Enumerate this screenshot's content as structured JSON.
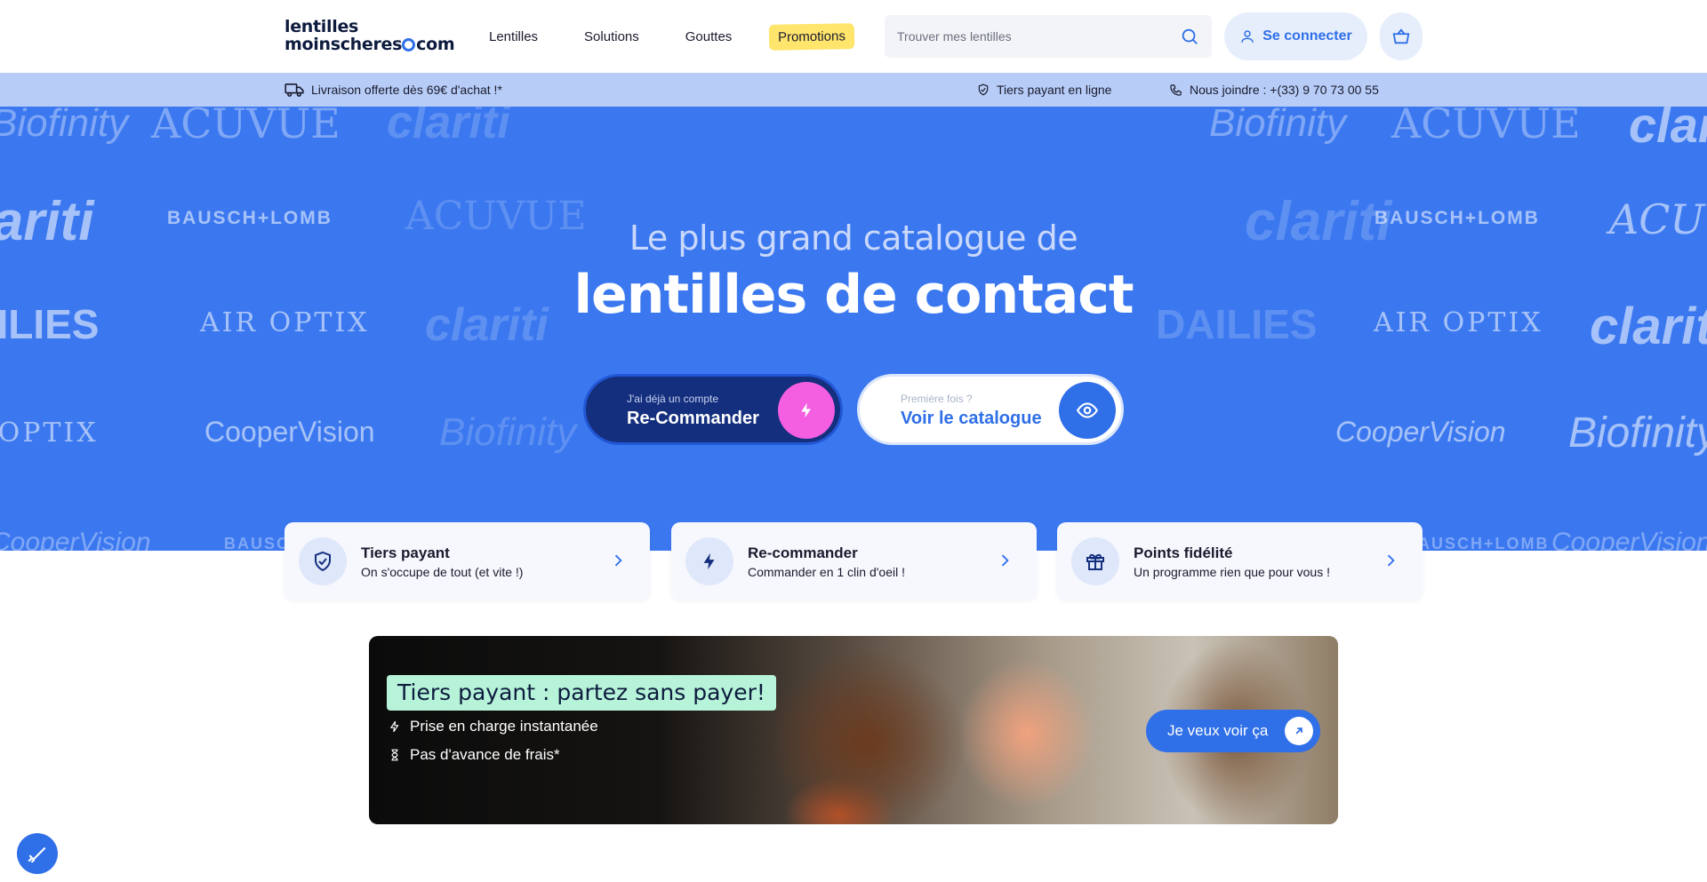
{
  "header": {
    "logo_line1": "lentilles",
    "logo_line2_a": "moinscheres",
    "logo_line2_b": "com",
    "nav": [
      "Lentilles",
      "Solutions",
      "Gouttes",
      "Promotions"
    ],
    "search_placeholder": "Trouver mes lentilles",
    "login_label": "Se connecter"
  },
  "infobar": {
    "delivery": "Livraison offerte dès 69€ d'achat !*",
    "tiers_payant": "Tiers payant en ligne",
    "contact": "Nous joindre : +(33) 9 70 73 00 55"
  },
  "hero": {
    "subtitle": "Le plus grand catalogue de",
    "title": "lentilles de contact",
    "brands": [
      "ACUVUE",
      "clariti",
      "BAUSCH+LOMB",
      "DAILIES",
      "AIR OPTIX",
      "CooperVision",
      "Biofinity"
    ],
    "reorder_small": "J'ai déjà un compte",
    "reorder_big": "Re-Commander",
    "catalog_small": "Première fois ?",
    "catalog_big": "Voir le catalogue"
  },
  "cards": [
    {
      "title": "Tiers payant",
      "subtitle": "On s'occupe de tout (et vite !)",
      "icon": "shield-check-icon"
    },
    {
      "title": "Re-commander",
      "subtitle": "Commander en 1 clin d'oeil !",
      "icon": "lightning-icon"
    },
    {
      "title": "Points fidélité",
      "subtitle": "Un programme rien que pour vous !",
      "icon": "gift-icon"
    }
  ],
  "banner": {
    "title": "Tiers payant : partez sans payer!",
    "line1": "Prise en charge instantanée",
    "line2": "Pas d'avance de frais*",
    "button": "Je veux voir ça"
  },
  "colors": {
    "primary": "#2f6fe8",
    "hero_bg": "#3b78f0",
    "infobar_bg": "#b7cdf7",
    "promo_highlight": "#ffe56b",
    "reorder_accent": "#f45ee0",
    "banner_tag": "#b6f3d8"
  }
}
